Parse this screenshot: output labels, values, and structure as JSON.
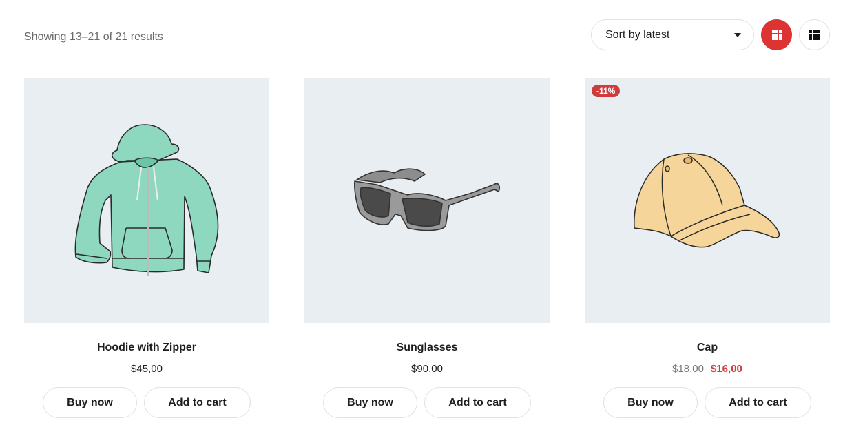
{
  "toolbar": {
    "result_count": "Showing 13–21 of 21 results",
    "sort": {
      "selected": "Sort by latest",
      "icon": "caret-down-icon"
    },
    "views": [
      {
        "name": "grid",
        "icon": "grid-icon",
        "active": true,
        "active_color": "#de3333"
      },
      {
        "name": "list",
        "icon": "list-icon",
        "active": false
      }
    ]
  },
  "products": [
    {
      "title": "Hoodie with Zipper",
      "image": "hoodie-illustration",
      "price": "$45,00",
      "buy_label": "Buy now",
      "cart_label": "Add to cart"
    },
    {
      "title": "Sunglasses",
      "image": "sunglasses-illustration",
      "price": "$90,00",
      "buy_label": "Buy now",
      "cart_label": "Add to cart"
    },
    {
      "title": "Cap",
      "image": "cap-illustration",
      "badge": "-11%",
      "regular_price": "$18,00",
      "sale_price": "$16,00",
      "buy_label": "Buy now",
      "cart_label": "Add to cart"
    }
  ],
  "colors": {
    "accent": "#de3333",
    "sale": "#d03b3b",
    "thumb_bg": "#e9eef3"
  }
}
